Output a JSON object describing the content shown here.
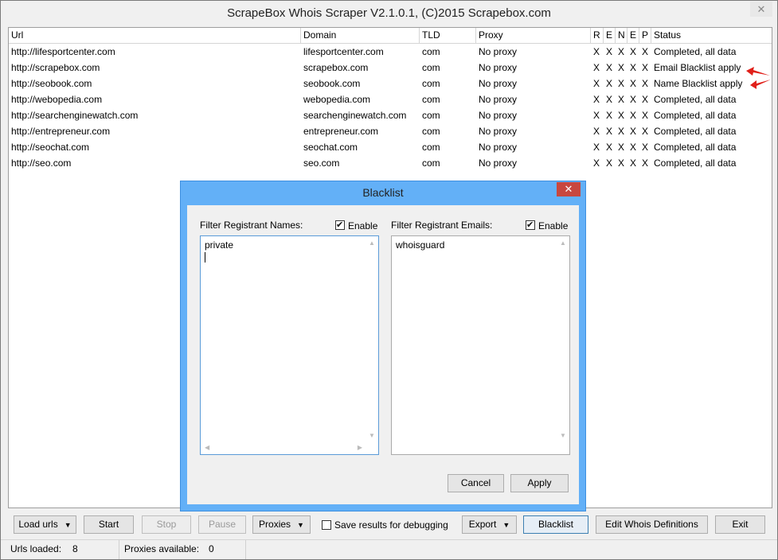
{
  "window": {
    "title": "ScrapeBox Whois Scraper V2.1.0.1, (C)2015 Scrapebox.com",
    "close_glyph": "✕"
  },
  "grid": {
    "headers": [
      "Url",
      "Domain",
      "TLD",
      "Proxy",
      "R",
      "E",
      "N",
      "E",
      "P",
      "Status"
    ],
    "rows": [
      [
        "http://lifesportcenter.com",
        "lifesportcenter.com",
        "com",
        "No proxy",
        "X",
        "X",
        "X",
        "X",
        "X",
        "Completed, all data"
      ],
      [
        "http://scrapebox.com",
        "scrapebox.com",
        "com",
        "No proxy",
        "X",
        "X",
        "X",
        "X",
        "X",
        "Email Blacklist apply"
      ],
      [
        "http://seobook.com",
        "seobook.com",
        "com",
        "No proxy",
        "X",
        "X",
        "X",
        "X",
        "X",
        "Name Blacklist apply"
      ],
      [
        "http://webopedia.com",
        "webopedia.com",
        "com",
        "No proxy",
        "X",
        "X",
        "X",
        "X",
        "X",
        "Completed, all data"
      ],
      [
        "http://searchenginewatch.com",
        "searchenginewatch.com",
        "com",
        "No proxy",
        "X",
        "X",
        "X",
        "X",
        "X",
        "Completed, all data"
      ],
      [
        "http://entrepreneur.com",
        "entrepreneur.com",
        "com",
        "No proxy",
        "X",
        "X",
        "X",
        "X",
        "X",
        "Completed, all data"
      ],
      [
        "http://seochat.com",
        "seochat.com",
        "com",
        "No proxy",
        "X",
        "X",
        "X",
        "X",
        "X",
        "Completed, all data"
      ],
      [
        "http://seo.com",
        "seo.com",
        "com",
        "No proxy",
        "X",
        "X",
        "X",
        "X",
        "X",
        "Completed, all data"
      ]
    ],
    "annotation_color": "#e0201a"
  },
  "dialog": {
    "title": "Blacklist",
    "close_glyph": "✕",
    "names_label": "Filter Registrant Names:",
    "names_enable_label": "Enable",
    "names_enabled": true,
    "names_text": "private",
    "emails_label": "Filter Registrant Emails:",
    "emails_enable_label": "Enable",
    "emails_enabled": true,
    "emails_text": "whoisguard",
    "cancel_label": "Cancel",
    "apply_label": "Apply"
  },
  "toolbar": {
    "load_urls": "Load urls",
    "start": "Start",
    "stop": "Stop",
    "pause": "Pause",
    "proxies": "Proxies",
    "save_debug_label": "Save results for debugging",
    "save_debug_checked": false,
    "export": "Export",
    "blacklist": "Blacklist",
    "edit_whois": "Edit Whois Definitions",
    "exit": "Exit",
    "dropdown_glyph": "▼"
  },
  "statusbar": {
    "urls_loaded_label": "Urls loaded:",
    "urls_loaded_value": "8",
    "proxies_available_label": "Proxies available:",
    "proxies_available_value": "0"
  },
  "colors": {
    "dialog_frame": "#63b0f7",
    "dialog_close": "#c8473f",
    "accent_border": "#5a9bd8"
  }
}
